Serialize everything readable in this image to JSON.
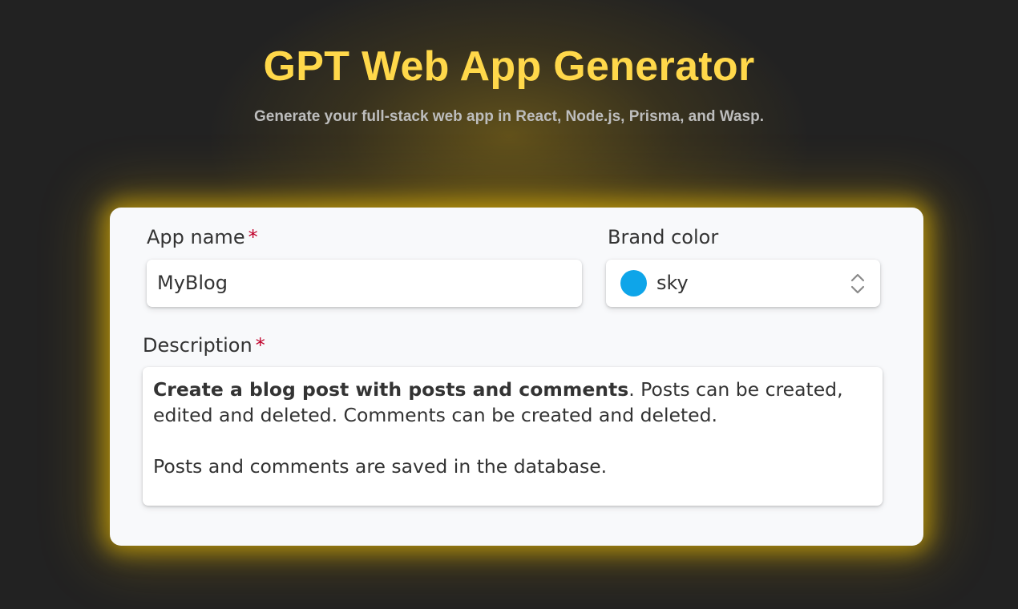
{
  "header": {
    "title": "GPT Web App Generator",
    "subtitle": "Generate your full-stack web app in React, Node.js, Prisma, and Wasp."
  },
  "form": {
    "app_name": {
      "label": "App name",
      "required_mark": "*",
      "value": "MyBlog"
    },
    "brand_color": {
      "label": "Brand color",
      "value": "sky",
      "swatch_color": "#0ea5e9",
      "icon": "chevron-up-down-icon"
    },
    "description": {
      "label": "Description",
      "required_mark": "*",
      "bold_part": "Create a blog post with posts and comments",
      "rest_part": ". Posts can be created, edited and deleted. Comments can be created and deleted.",
      "second_paragraph": "Posts and comments are saved in the database."
    }
  },
  "colors": {
    "background": "#222222",
    "title": "#ffd84a",
    "glow": "#ffcc00",
    "required": "#c0002a",
    "card": "#f8f9fb"
  }
}
